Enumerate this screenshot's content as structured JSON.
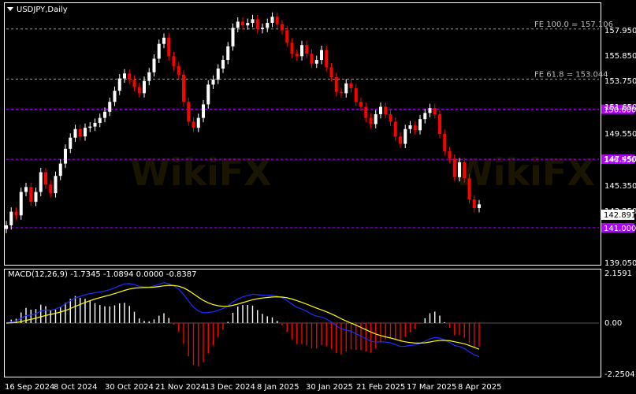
{
  "chart_title": "USDJPY,Daily",
  "price_axis_labels": [
    "157.950",
    "155.850",
    "153.750",
    "151.650",
    "149.550",
    "147.450",
    "145.350",
    "143.250",
    "139.050"
  ],
  "current_price": "142.891",
  "levels": [
    {
      "value": 157.106,
      "text": "FE 100.0 = 157.106",
      "style": "fib"
    },
    {
      "value": 153.044,
      "text": "FE 61.8 = 153.044",
      "style": "fib"
    },
    {
      "value": 150.6,
      "text": "150.600",
      "style": "magenta"
    },
    {
      "value": 146.55,
      "text": "146.550",
      "style": "magenta"
    },
    {
      "value": 141.0,
      "text": "141.000",
      "style": "magenta"
    }
  ],
  "macd": {
    "label": "MACD(12,26,9) -1.7345 -1.0894 0.0000 -0.8387",
    "axis_labels": [
      "2.1591",
      "0.00",
      "-2.2504"
    ]
  },
  "date_labels": [
    "16 Sep 2024",
    "8 Oct 2024",
    "30 Oct 2024",
    "21 Nov 2024",
    "13 Dec 2024",
    "8 Jan 2025",
    "30 Jan 2025",
    "21 Feb 2025",
    "17 Mar 2025",
    "8 Apr 2025"
  ],
  "colors": {
    "background": "#000000",
    "grid": "#7f7f7f",
    "bull": "#ffffff",
    "bear": "#ff0000",
    "magenta": "#b000ff",
    "macd_signal": "#ffff00",
    "macd_main": "#1f2cff",
    "hist_pos": "#ffffff",
    "hist_neg": "#ff0000"
  },
  "icons": {
    "menu": "caret-down-icon"
  },
  "chart_data": {
    "type": "candlestick",
    "symbol": "USDJPY",
    "timeframe": "Daily",
    "price_range": [
      138.0,
      159.2
    ],
    "macd_range": [
      -2.45,
      2.45
    ],
    "close_series": [
      141.2,
      142.3,
      142.0,
      143.9,
      144.3,
      143.1,
      143.9,
      145.5,
      144.5,
      143.8,
      145.2,
      146.2,
      147.4,
      148.3,
      149.0,
      148.4,
      149.1,
      149.2,
      149.5,
      149.9,
      150.4,
      151.2,
      152.1,
      153.1,
      153.5,
      153.0,
      152.4,
      151.9,
      152.9,
      153.6,
      154.7,
      155.9,
      156.4,
      154.9,
      154.1,
      153.4,
      151.2,
      149.6,
      149.1,
      149.9,
      151.0,
      152.6,
      153.0,
      153.9,
      154.6,
      155.7,
      157.2,
      157.7,
      157.4,
      157.6,
      157.9,
      157.1,
      157.2,
      157.6,
      158.1,
      157.5,
      157.0,
      156.0,
      155.1,
      154.9,
      155.8,
      155.1,
      154.3,
      154.6,
      155.4,
      154.0,
      153.2,
      152.0,
      151.9,
      152.7,
      152.3,
      151.2,
      150.8,
      149.9,
      149.4,
      150.2,
      150.8,
      150.2,
      149.6,
      148.4,
      147.8,
      149.0,
      149.3,
      148.9,
      149.8,
      150.3,
      150.7,
      150.2,
      148.6,
      147.2,
      146.6,
      145.1,
      146.3,
      145.0,
      143.3,
      142.6,
      142.9
    ]
  }
}
